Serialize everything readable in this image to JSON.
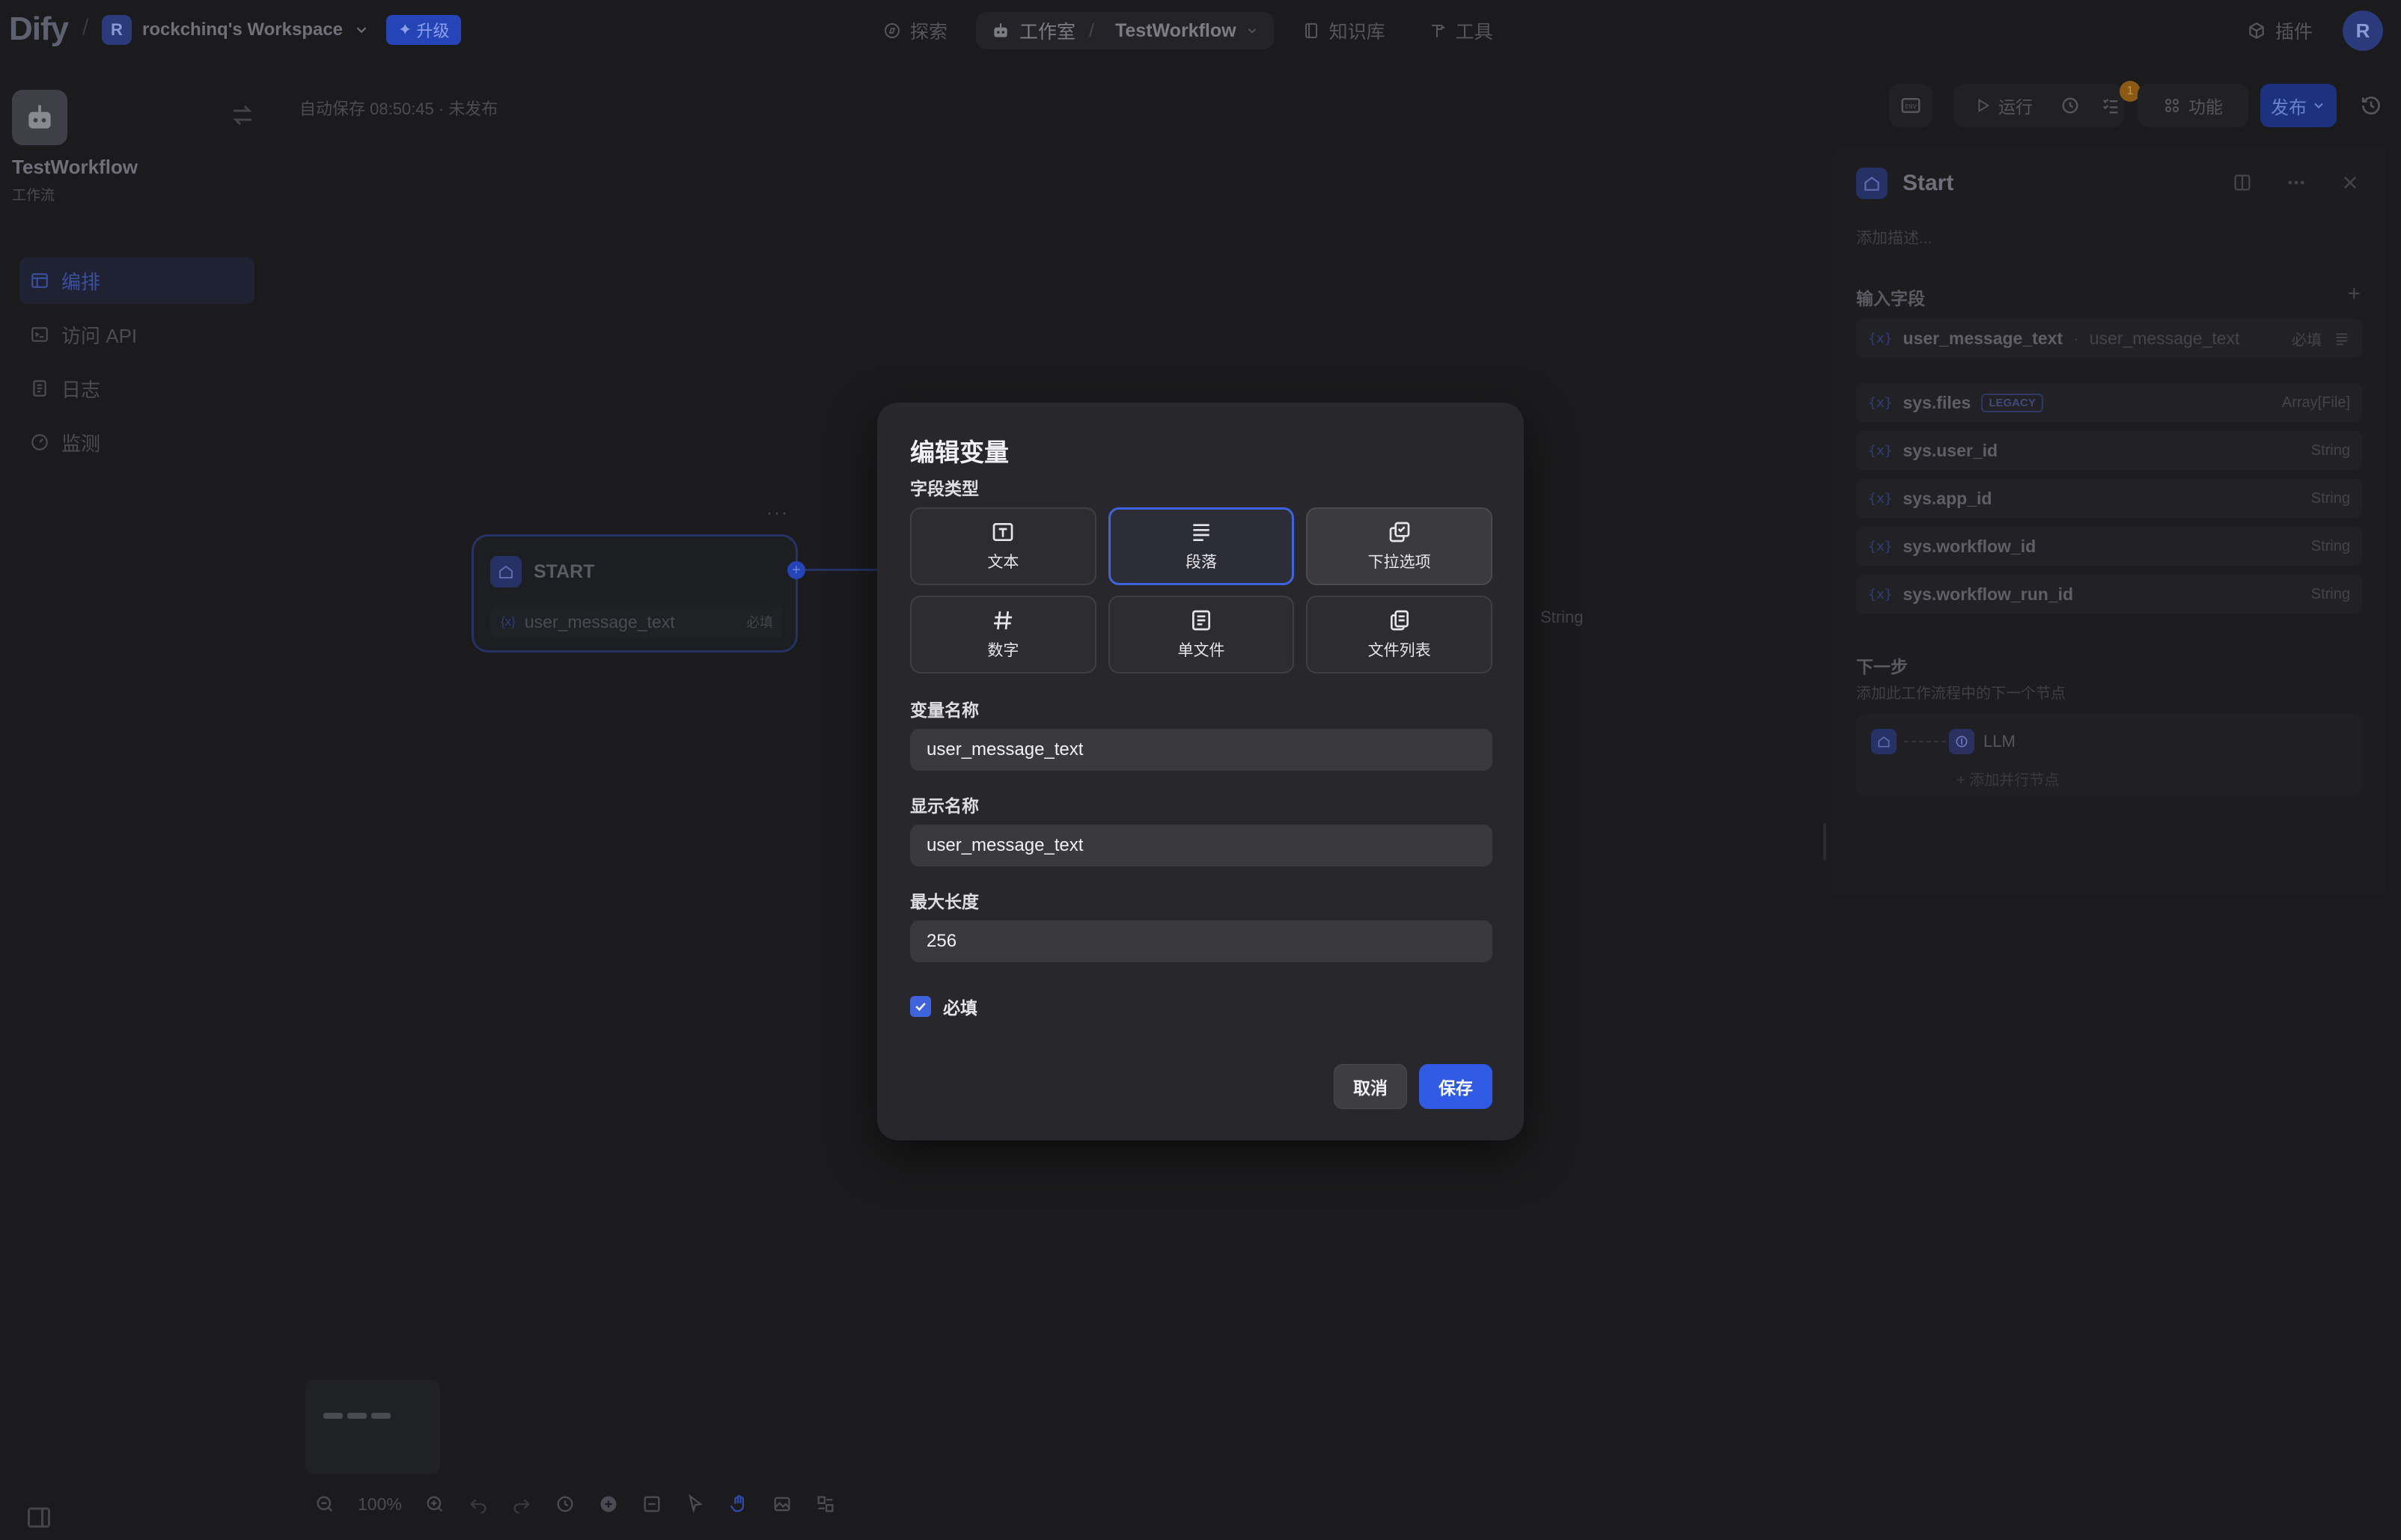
{
  "topbar": {
    "logo": "Dify",
    "workspace_initial": "R",
    "workspace_name": "rockchinq's Workspace",
    "upgrade_label": "升级",
    "nav": {
      "explore": "探索",
      "studio": "工作室",
      "workflow_name": "TestWorkflow",
      "knowledge": "知识库",
      "tools": "工具"
    },
    "plugins": "插件",
    "user_initial": "R"
  },
  "sidebar": {
    "app_name": "TestWorkflow",
    "app_type": "工作流",
    "items": [
      {
        "label": "编排",
        "active": true
      },
      {
        "label": "访问 API",
        "active": false
      },
      {
        "label": "日志",
        "active": false
      },
      {
        "label": "监测",
        "active": false
      }
    ]
  },
  "canvas": {
    "autosave": "自动保存 08:50:45 · 未发布",
    "start_node": {
      "title": "START",
      "var_name": "user_message_text",
      "required": "必填"
    },
    "ghost_type": "String",
    "zoom": "100%"
  },
  "toolbar": {
    "env": "ENV",
    "run": "运行",
    "features": "功能",
    "publish": "发布",
    "checklist_count": "1"
  },
  "panel": {
    "title": "Start",
    "description_placeholder": "添加描述...",
    "input_fields_label": "输入字段",
    "input_var": {
      "name": "user_message_text",
      "label": "user_message_text",
      "required": "必填"
    },
    "system_vars": [
      {
        "name": "sys.files",
        "type": "Array[File]",
        "tag": "LEGACY"
      },
      {
        "name": "sys.user_id",
        "type": "String"
      },
      {
        "name": "sys.app_id",
        "type": "String"
      },
      {
        "name": "sys.workflow_id",
        "type": "String"
      },
      {
        "name": "sys.workflow_run_id",
        "type": "String"
      }
    ],
    "next_step_label": "下一步",
    "next_step_sub": "添加此工作流程中的下一个节点",
    "next_node": "LLM",
    "add_parallel": "添加并行节点"
  },
  "modal": {
    "title": "编辑变量",
    "field_type_label": "字段类型",
    "types": [
      {
        "label": "文本",
        "icon": "text-input-icon"
      },
      {
        "label": "段落",
        "icon": "paragraph-icon",
        "selected": true
      },
      {
        "label": "下拉选项",
        "icon": "select-icon"
      },
      {
        "label": "数字",
        "icon": "number-icon"
      },
      {
        "label": "单文件",
        "icon": "file-icon"
      },
      {
        "label": "文件列表",
        "icon": "file-list-icon"
      }
    ],
    "variable_name_label": "变量名称",
    "variable_name_value": "user_message_text",
    "display_name_label": "显示名称",
    "display_name_value": "user_message_text",
    "max_length_label": "最大长度",
    "max_length_value": "256",
    "required_label": "必填",
    "required_checked": true,
    "cancel_label": "取消",
    "save_label": "保存"
  },
  "colors": {
    "background": "#1b1b1d",
    "modal": "#28282c",
    "accent": "#2f5be6",
    "selected_border": "#3f63dc"
  }
}
